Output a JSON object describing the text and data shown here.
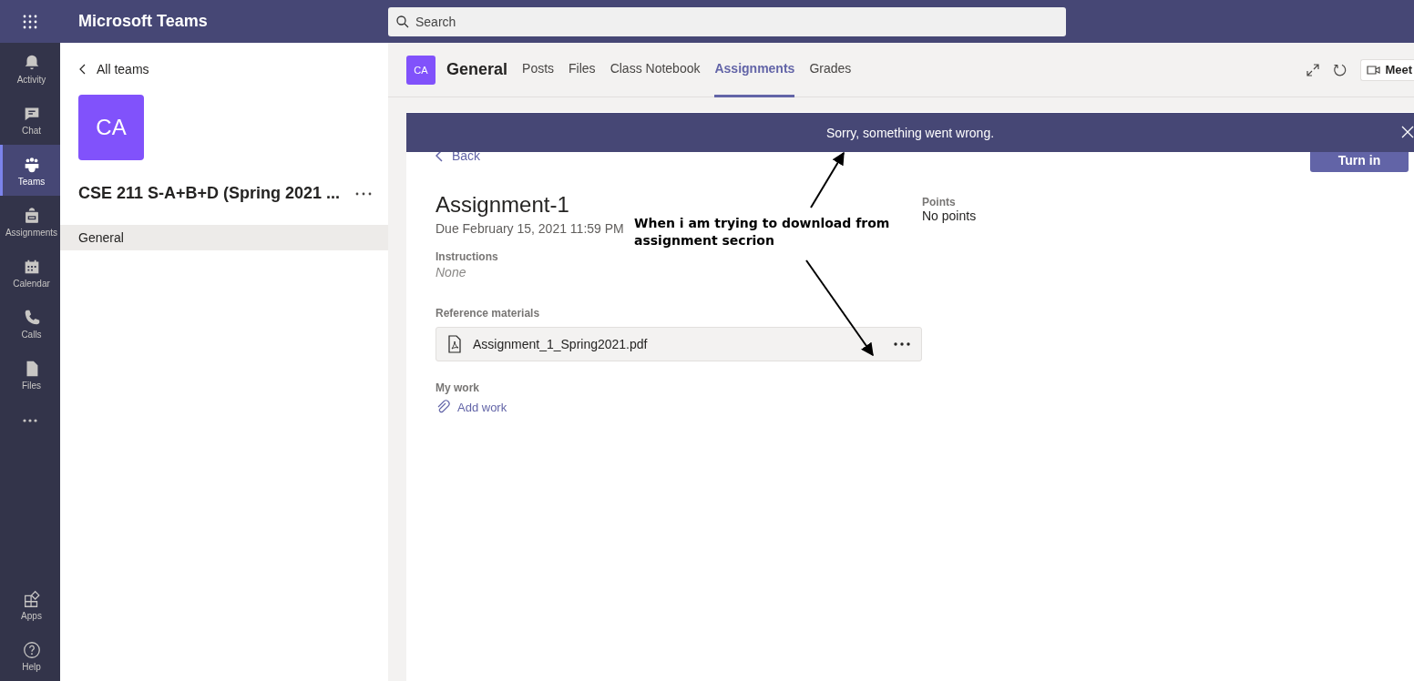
{
  "app": {
    "title": "Microsoft Teams"
  },
  "search": {
    "placeholder": "Search"
  },
  "rail": {
    "items": [
      {
        "label": "Activity",
        "kind": "bell",
        "selected": false
      },
      {
        "label": "Chat",
        "kind": "chat",
        "selected": false
      },
      {
        "label": "Teams",
        "kind": "teams",
        "selected": true
      },
      {
        "label": "Assignments",
        "kind": "bag",
        "selected": false
      },
      {
        "label": "Calendar",
        "kind": "calendar",
        "selected": false
      },
      {
        "label": "Calls",
        "kind": "phone",
        "selected": false
      },
      {
        "label": "Files",
        "kind": "file",
        "selected": false
      }
    ],
    "bottom_items": [
      {
        "label": "Apps",
        "kind": "apps",
        "selected": false
      },
      {
        "label": "Help",
        "kind": "help",
        "selected": false
      }
    ]
  },
  "team_panel": {
    "back_link": "All teams",
    "avatar": "CA",
    "team_name": "CSE 211 S-A+B+D (Spring 2021 ...",
    "channels": [
      {
        "label": "General",
        "selected": true
      }
    ]
  },
  "channel_header": {
    "avatar": "CA",
    "title": "General",
    "tabs": [
      {
        "label": "Posts",
        "selected": false
      },
      {
        "label": "Files",
        "selected": false
      },
      {
        "label": "Class Notebook",
        "selected": false
      },
      {
        "label": "Assignments",
        "selected": true
      },
      {
        "label": "Grades",
        "selected": false
      }
    ],
    "meet_button": "Meet"
  },
  "banner": {
    "message": "Sorry, something went wrong."
  },
  "assignment": {
    "back": "Back",
    "turn_in": "Turn in",
    "title": "Assignment-1",
    "due": "Due February 15, 2021 11:59 PM",
    "points_label": "Points",
    "points_value": "No points",
    "instructions_label": "Instructions",
    "instructions": "None",
    "reference_label": "Reference materials",
    "files": [
      {
        "name": "Assignment_1_Spring2021.pdf"
      }
    ],
    "my_work_label": "My work",
    "add_work": "Add work"
  },
  "annotation": {
    "text": "When i am trying to download from assignment secrion"
  }
}
